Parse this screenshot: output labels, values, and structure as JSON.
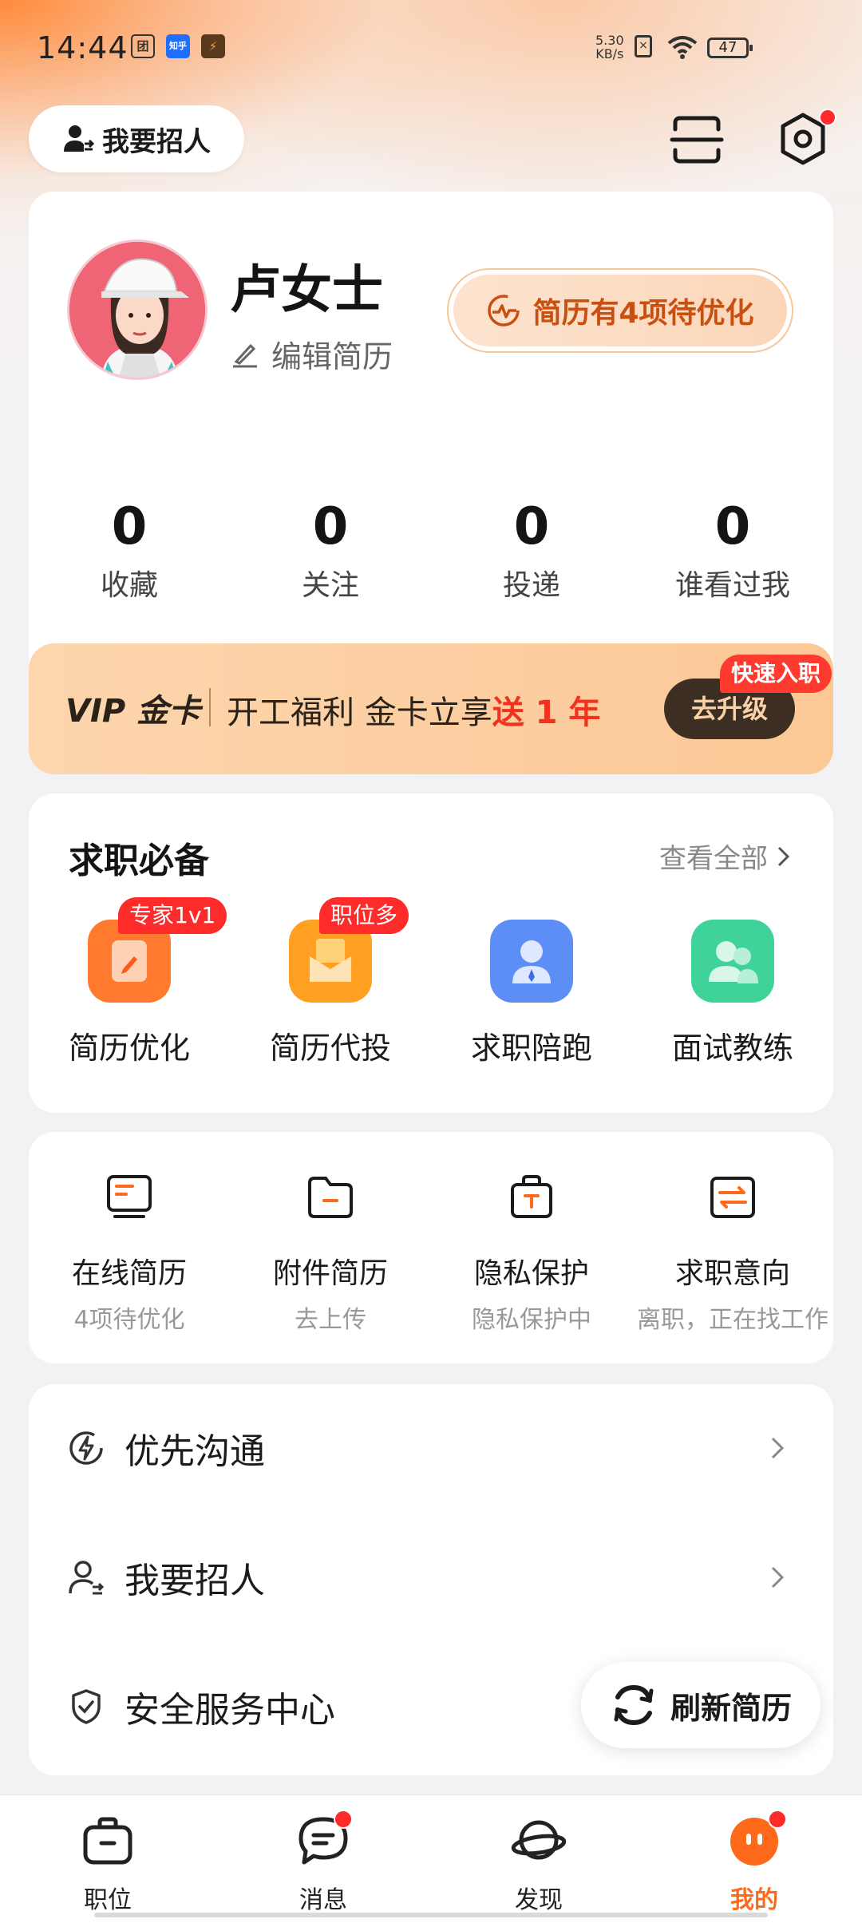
{
  "status_bar": {
    "time": "14:44",
    "net_speed_value": "5.30",
    "net_speed_unit": "KB/s",
    "battery": "47",
    "app_icons": [
      "团",
      "知乎",
      "⚡"
    ]
  },
  "header": {
    "recruit_label": "我要招人",
    "scan_icon": "scan-icon",
    "settings_icon": "gear-icon",
    "settings_has_dot": true
  },
  "profile": {
    "name": "卢女士",
    "edit_label": "编辑简历",
    "optimize_label": "简历有4项待优化"
  },
  "stats": [
    {
      "value": "0",
      "label": "收藏"
    },
    {
      "value": "0",
      "label": "关注"
    },
    {
      "value": "0",
      "label": "投递"
    },
    {
      "value": "0",
      "label": "谁看过我"
    }
  ],
  "vip": {
    "logo_text": "VIP 金卡",
    "promo_text": "开工福利 金卡立享",
    "promo_highlight": "送 1 年",
    "upgrade_label": "去升级",
    "tag": "快速入职"
  },
  "essentials": {
    "title": "求职必备",
    "see_all": "查看全部",
    "items": [
      {
        "label": "简历优化",
        "tag": "专家1v1",
        "color": "#ff7a2e"
      },
      {
        "label": "简历代投",
        "tag": "职位多",
        "color": "#ffa023"
      },
      {
        "label": "求职陪跑",
        "tag": "",
        "color": "#5c8ef5"
      },
      {
        "label": "面试教练",
        "tag": "",
        "color": "#3fd39a"
      }
    ]
  },
  "resume_tools": [
    {
      "label": "在线简历",
      "sub": "4项待优化"
    },
    {
      "label": "附件简历",
      "sub": "去上传"
    },
    {
      "label": "隐私保护",
      "sub": "隐私保护中"
    },
    {
      "label": "求职意向",
      "sub": "离职，正在找工作"
    }
  ],
  "list": [
    {
      "label": "优先沟通"
    },
    {
      "label": "我要招人"
    },
    {
      "label": "安全服务中心"
    }
  ],
  "refresh_label": "刷新简历",
  "tabs": [
    {
      "label": "职位",
      "dot": false
    },
    {
      "label": "消息",
      "dot": true
    },
    {
      "label": "发现",
      "dot": false
    },
    {
      "label": "我的",
      "dot": true
    }
  ],
  "accent_color": "#ff6a1a"
}
